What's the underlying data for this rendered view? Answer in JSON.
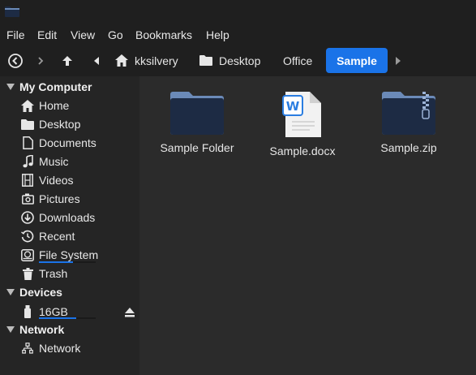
{
  "menubar": {
    "items": [
      "File",
      "Edit",
      "View",
      "Go",
      "Bookmarks",
      "Help"
    ]
  },
  "breadcrumb": {
    "items": [
      "kksilvery",
      "Desktop",
      "Office",
      "Sample"
    ],
    "active_index": 3
  },
  "sidebar": {
    "sections": [
      {
        "title": "My Computer",
        "items": [
          "Home",
          "Desktop",
          "Documents",
          "Music",
          "Videos",
          "Pictures",
          "Downloads",
          "Recent",
          "File System",
          "Trash"
        ]
      },
      {
        "title": "Devices",
        "items": [
          "16GB"
        ]
      },
      {
        "title": "Network",
        "items": [
          "Network"
        ]
      }
    ],
    "usage": {
      "file_system_fraction": 0.6,
      "device_fraction": 0.65
    }
  },
  "files": [
    {
      "name": "Sample Folder",
      "icon": "folder-icon"
    },
    {
      "name": "Sample.docx",
      "icon": "docx-icon"
    },
    {
      "name": "Sample.zip",
      "icon": "zip-folder-icon"
    }
  ],
  "colors": {
    "accent": "#1a73e8",
    "folder": "#1d2b44",
    "folder_tab": "#6b8ab8"
  }
}
